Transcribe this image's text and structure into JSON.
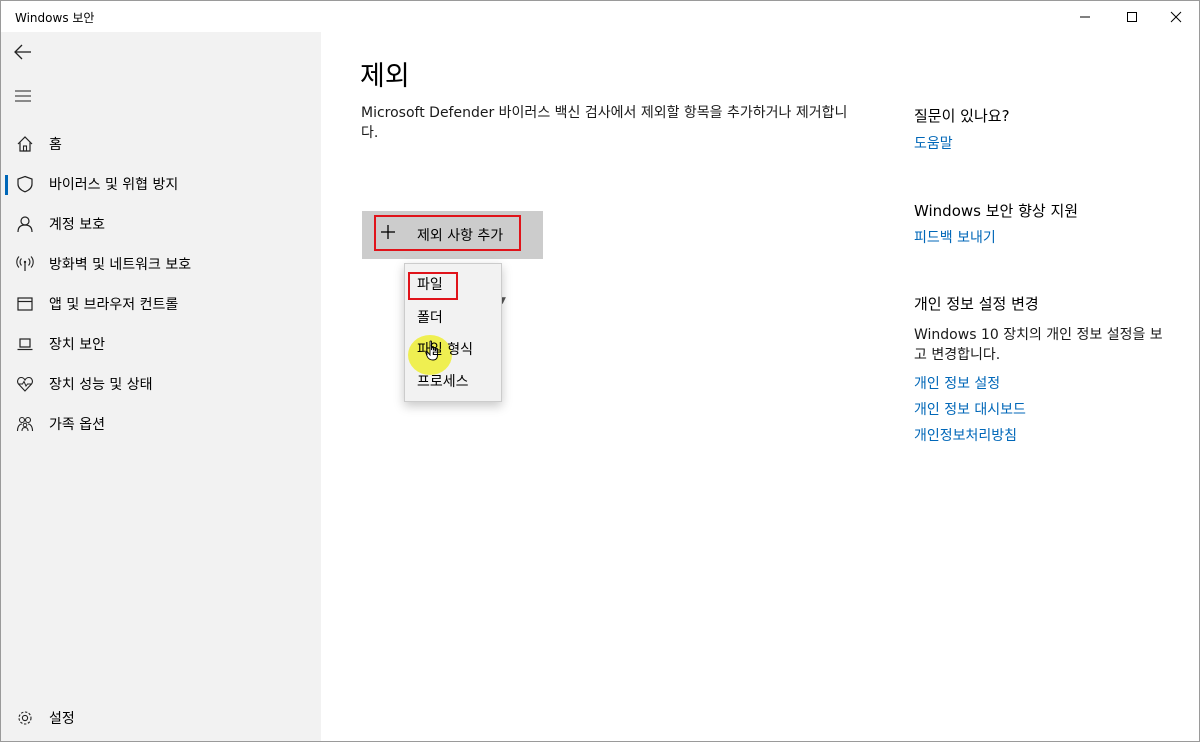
{
  "window": {
    "title": "Windows 보안"
  },
  "sidebar": {
    "items": [
      {
        "label": "홈",
        "icon": "home-icon"
      },
      {
        "label": "바이러스 및 위협 방지",
        "icon": "shield-icon",
        "active": true
      },
      {
        "label": "계정 보호",
        "icon": "person-icon"
      },
      {
        "label": "방화벽 및 네트워크 보호",
        "icon": "wireless-icon"
      },
      {
        "label": "앱 및 브라우저 컨트롤",
        "icon": "app-window-icon"
      },
      {
        "label": "장치 보안",
        "icon": "laptop-icon"
      },
      {
        "label": "장치 성능 및 상태",
        "icon": "heart-pulse-icon"
      },
      {
        "label": "가족 옵션",
        "icon": "family-icon"
      }
    ],
    "settings_label": "설정"
  },
  "main": {
    "title": "제외",
    "description": "Microsoft Defender 바이러스 백신 검사에서 제외할 항목을 추가하거나 제거합니다.",
    "add_button_label": "제외 사항 추가",
    "menu": [
      {
        "label": "파일"
      },
      {
        "label": "폴더"
      },
      {
        "label": "파일 형식"
      },
      {
        "label": "프로세스"
      }
    ]
  },
  "right": {
    "question_heading": "질문이 있나요?",
    "help_link": "도움말",
    "improve_heading": "Windows 보안 향상 지원",
    "feedback_link": "피드백 보내기",
    "privacy_heading": "개인 정보 설정 변경",
    "privacy_text": "Windows 10 장치의 개인 정보 설정을 보고 변경합니다.",
    "privacy_links": [
      "개인 정보 설정",
      "개인 정보 대시보드",
      "개인정보처리방침"
    ]
  },
  "colors": {
    "accent": "#0067b8",
    "highlight": "#e0131a",
    "sidebar_bg": "#f2f2f2"
  }
}
